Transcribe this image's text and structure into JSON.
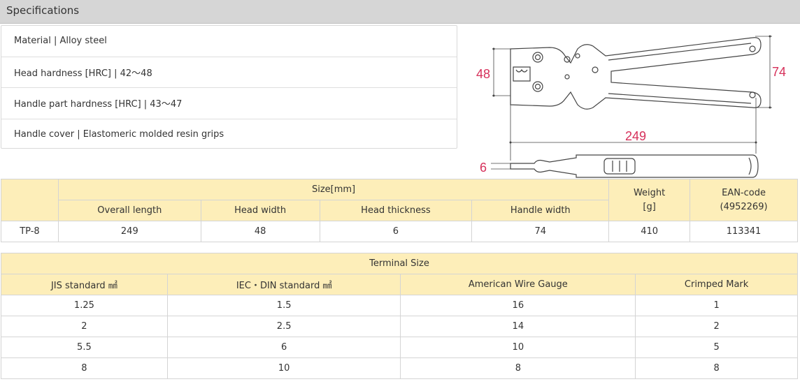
{
  "header": {
    "title": "Specifications"
  },
  "specs": [
    "Material | Alloy steel",
    "Head hardness [HRC] | 42～48",
    "Handle part hardness [HRC] | 43～47",
    "Handle cover | Elastomeric molded resin grips"
  ],
  "diagram": {
    "dim_head_width": "48",
    "dim_handle_width": "74",
    "dim_length": "249",
    "dim_thickness": "6",
    "accent_color": "#d6305a"
  },
  "size_table": {
    "size_group": "Size[mm]",
    "weight_label": "Weight",
    "weight_unit": "[g]",
    "ean_label": "EAN-code",
    "ean_prefix": "(4952269)",
    "columns": [
      "Overall length",
      "Head width",
      "Head thickness",
      "Handle width"
    ],
    "row": {
      "model": "TP-8",
      "overall_length": "249",
      "head_width": "48",
      "head_thickness": "6",
      "handle_width": "74",
      "weight": "410",
      "ean": "113341"
    }
  },
  "terminal_table": {
    "title": "Terminal Size",
    "columns": [
      "JIS standard ㎟",
      "IEC・DIN standard ㎟",
      "American Wire Gauge",
      "Crimped Mark"
    ],
    "rows": [
      [
        "1.25",
        "1.5",
        "16",
        "1"
      ],
      [
        "2",
        "2.5",
        "14",
        "2"
      ],
      [
        "5.5",
        "6",
        "10",
        "5"
      ],
      [
        "8",
        "10",
        "8",
        "8"
      ]
    ]
  }
}
